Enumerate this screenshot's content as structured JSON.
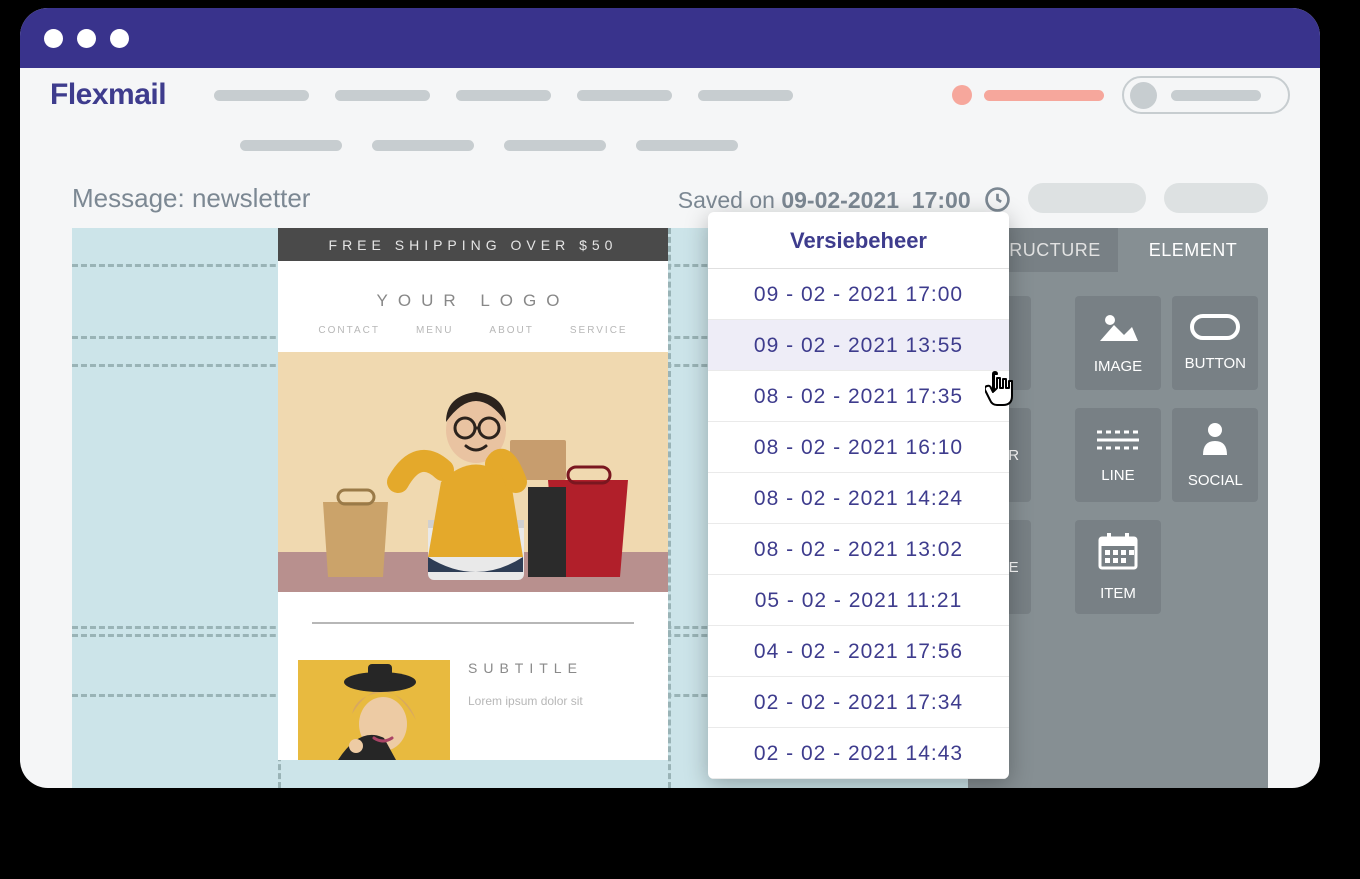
{
  "brand": "Flexmail",
  "page_title": "Message: newsletter",
  "saved": {
    "label": "Saved on",
    "date": "09-02-2021",
    "time": "17:00"
  },
  "version_dropdown": {
    "title": "Versiebeheer",
    "entries": [
      "09 - 02 - 2021  17:00",
      "09 - 02 - 2021  13:55",
      "08 - 02 - 2021  17:35",
      "08 - 02 - 2021  16:10",
      "08 - 02 - 2021  14:24",
      "08 - 02 - 2021  13:02",
      "05 - 02 - 2021  11:21",
      "04 - 02 - 2021  17:56",
      "02 - 02 - 2021  17:34",
      "02 - 02 - 2021  14:43"
    ],
    "hover_index": 1
  },
  "email": {
    "banner": "FREE SHIPPING OVER $50",
    "logo": "YOUR LOGO",
    "nav": {
      "a": "CONTACT",
      "b": "MENU",
      "c": "ABOUT",
      "d": "SERVICE"
    },
    "card": {
      "subtitle": "SUBTITLE",
      "lorem": "Lorem ipsum dolor sit"
    }
  },
  "side_panel": {
    "tab_a": "STRUCTURE",
    "tab_b": "ELEMENT",
    "tiles": {
      "image": "IMAGE",
      "button": "BUTTON",
      "r": "R",
      "line": "LINE",
      "social": "SOCIAL",
      "e": "E",
      "item": "ITEM"
    }
  }
}
